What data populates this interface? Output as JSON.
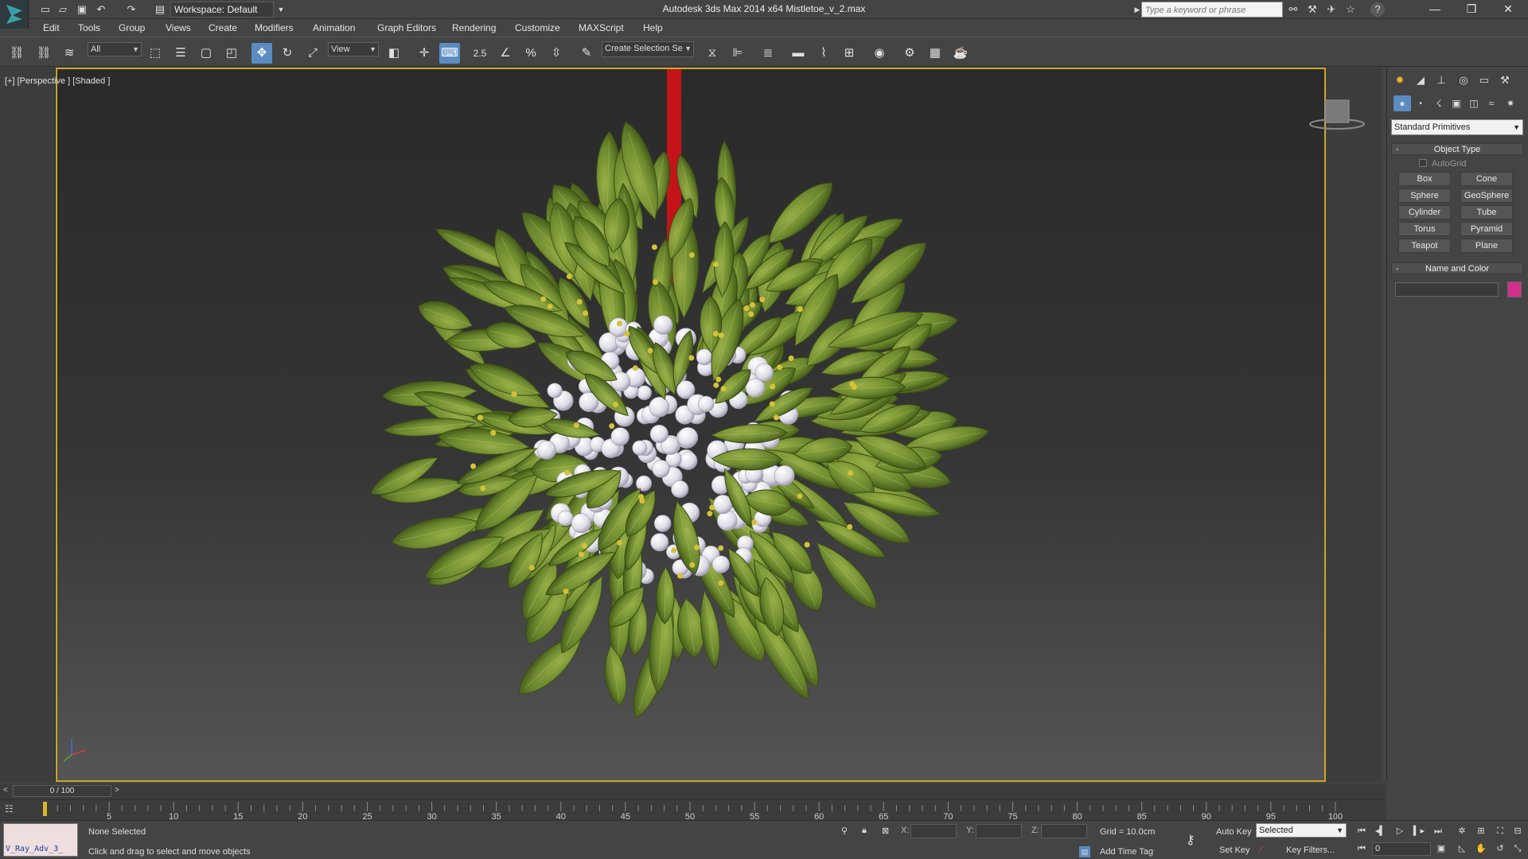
{
  "titlebar": {
    "workspace": "Workspace: Default",
    "title": "Autodesk 3ds Max  2014 x64     Mistletoe_v_2.max",
    "search_placeholder": "Type a keyword or phrase"
  },
  "menu": [
    "Edit",
    "Tools",
    "Group",
    "Views",
    "Create",
    "Modifiers",
    "Animation",
    "Graph Editors",
    "Rendering",
    "Customize",
    "MAXScript",
    "Help"
  ],
  "toolbar": {
    "selection_filter": "All",
    "reference_coord": "View",
    "snap_label": "2.5",
    "named_selection": "Create Selection Se"
  },
  "viewport": {
    "label": "[+] [Perspective ] [Shaded ]"
  },
  "command_panel": {
    "category": "Standard Primitives",
    "object_type_title": "Object Type",
    "autogrid": "AutoGrid",
    "primitives": [
      "Box",
      "Cone",
      "Sphere",
      "GeoSphere",
      "Cylinder",
      "Tube",
      "Torus",
      "Pyramid",
      "Teapot",
      "Plane"
    ],
    "name_color_title": "Name and Color",
    "object_color": "#d0308c"
  },
  "timeline": {
    "slider": "0 / 100",
    "ticks": [
      5,
      10,
      15,
      20,
      25,
      30,
      35,
      40,
      45,
      50,
      55,
      60,
      65,
      70,
      75,
      80,
      85,
      90,
      95,
      100
    ]
  },
  "status": {
    "maxscript_line": "V_Ray_Adv_3_",
    "selection": "None Selected",
    "prompt": "Click and drag to select and move objects",
    "x_label": "X:",
    "y_label": "Y:",
    "z_label": "Z:",
    "grid": "Grid = 10.0cm",
    "add_time_tag": "Add Time Tag",
    "auto_key": "Auto Key",
    "set_key": "Set Key",
    "selected_mode": "Selected",
    "key_filters": "Key Filters...",
    "current_frame": "0"
  },
  "colors": {
    "viewport_border": "#c9a72a",
    "active_tool": "#5a8cc2",
    "leaf": "#6d8a2e",
    "berry": "#e6e6ee",
    "ribbon": "#c4141a"
  }
}
